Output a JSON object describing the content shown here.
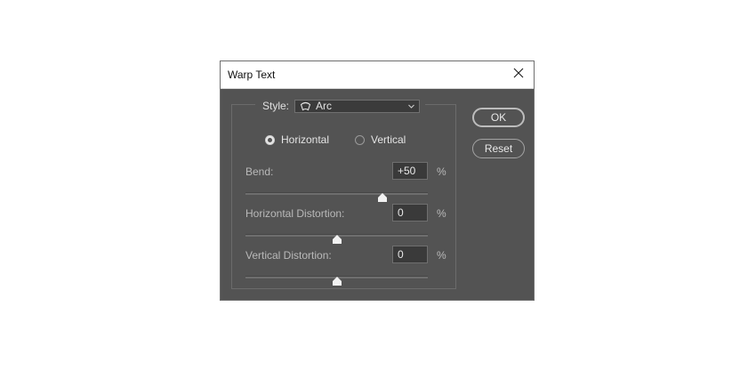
{
  "window": {
    "title": "Warp Text",
    "close_icon": "close-icon"
  },
  "style": {
    "label": "Style:",
    "selected": "Arc",
    "icon": "arc-icon"
  },
  "orientation": {
    "horizontal_label": "Horizontal",
    "vertical_label": "Vertical",
    "selected": "Horizontal"
  },
  "bend": {
    "label": "Bend:",
    "value": "+50",
    "unit": "%",
    "slider_fraction": 0.75
  },
  "horizontal_distortion": {
    "label": "Horizontal Distortion:",
    "value": "0",
    "unit": "%",
    "slider_fraction": 0.5
  },
  "vertical_distortion": {
    "label": "Vertical Distortion:",
    "value": "0",
    "unit": "%",
    "slider_fraction": 0.5
  },
  "buttons": {
    "ok": "OK",
    "reset": "Reset"
  },
  "colors": {
    "dialog_bg": "#535353",
    "titlebar_bg": "#ffffff",
    "input_bg": "#3a3a3a"
  }
}
